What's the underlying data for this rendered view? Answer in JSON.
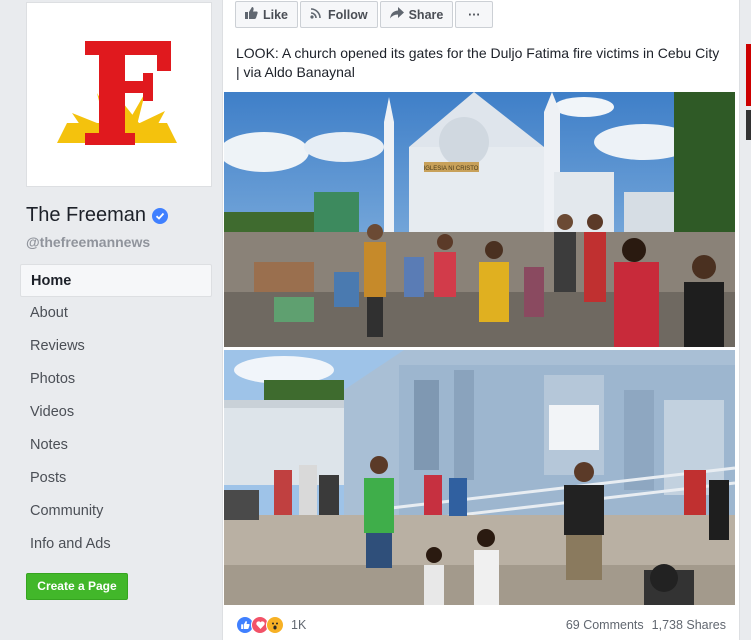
{
  "page": {
    "name": "The Freeman",
    "handle": "@thefreemannews",
    "logo_letter": "F"
  },
  "nav": {
    "items": [
      {
        "label": "Home"
      },
      {
        "label": "About"
      },
      {
        "label": "Reviews"
      },
      {
        "label": "Photos"
      },
      {
        "label": "Videos"
      },
      {
        "label": "Notes"
      },
      {
        "label": "Posts"
      },
      {
        "label": "Community"
      },
      {
        "label": "Info and Ads"
      }
    ],
    "create_page_label": "Create a Page"
  },
  "actions": {
    "like_label": "Like",
    "follow_label": "Follow",
    "share_label": "Share",
    "more_label": "···"
  },
  "post": {
    "text": "LOOK: A church opened its gates for the Duljo Fatima fire victims in Cebu City | via Aldo Banaynal",
    "photo1_sign": "IGLESIA NI CRISTO",
    "reactions_count": "1K",
    "comments": "69 Comments",
    "shares": "1,738 Shares"
  },
  "colors": {
    "brand_red": "#e0191e",
    "brand_yellow": "#f4c20d",
    "verified_blue": "#4080ff",
    "create_green": "#42b72a"
  },
  "icons": [
    "like-icon",
    "follow-icon",
    "share-icon",
    "more-icon",
    "verified-icon"
  ]
}
